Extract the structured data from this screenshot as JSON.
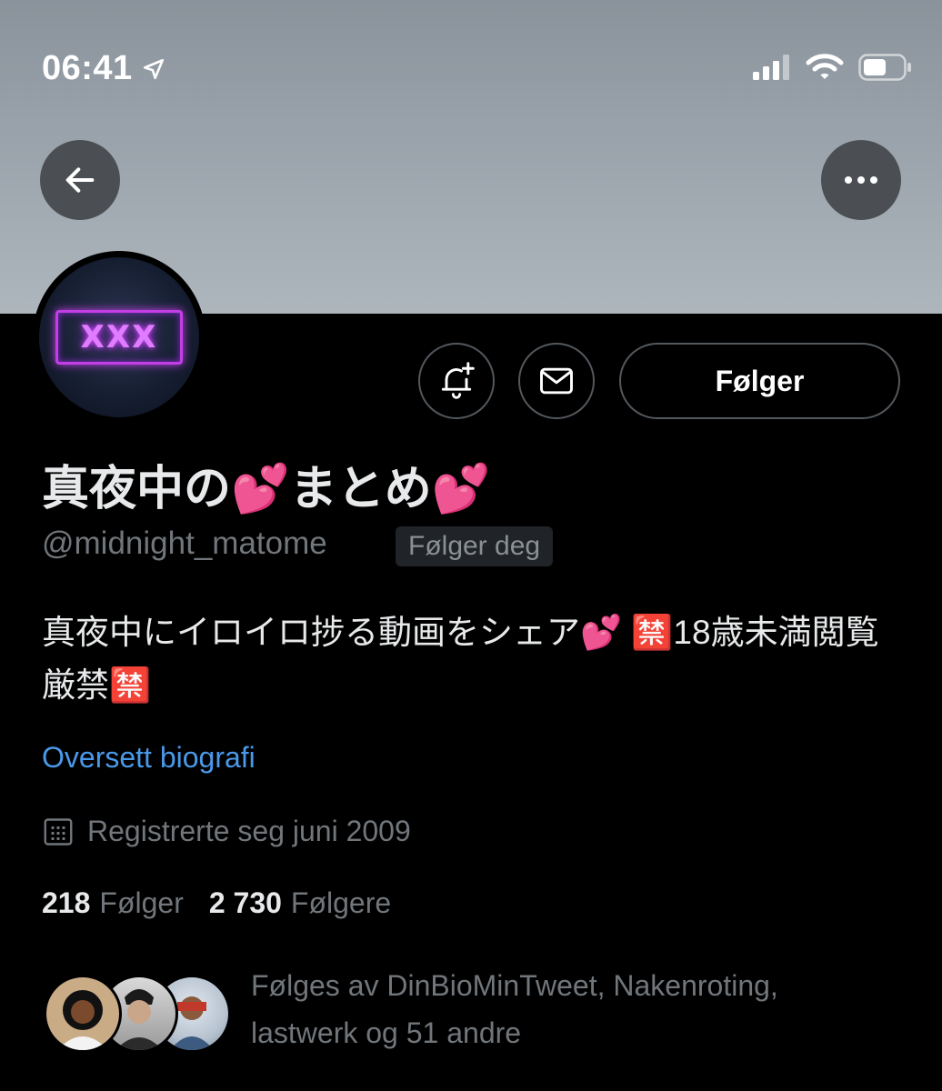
{
  "status_bar": {
    "time": "06:41"
  },
  "profile": {
    "avatar_text": "XXX",
    "display_name": "真夜中の💕まとめ💕",
    "handle": "@midnight_matome",
    "follows_you_badge": "Følger deg",
    "bio": "真夜中にイロイロ捗る動画をシェア💕 🈲18歳未満閲覧厳禁🈲",
    "translate_link": "Oversett biografi",
    "joined": "Registrerte seg juni 2009",
    "following_count": "218",
    "following_label": "Følger",
    "followers_count": "2 730",
    "followers_label": "Følgere",
    "followed_by": "Følges av DinBioMinTweet, Nakenroting, lastwerk og 51 andre"
  },
  "actions": {
    "follow_button": "Følger"
  },
  "colors": {
    "link": "#4a99e9",
    "muted": "#71767b",
    "neon": "#c23fe6"
  },
  "icons": [
    "back-arrow-icon",
    "more-icon",
    "bell-plus-icon",
    "mail-icon",
    "calendar-icon",
    "location-arrow-icon",
    "signal-icon",
    "wifi-icon",
    "battery-icon"
  ]
}
